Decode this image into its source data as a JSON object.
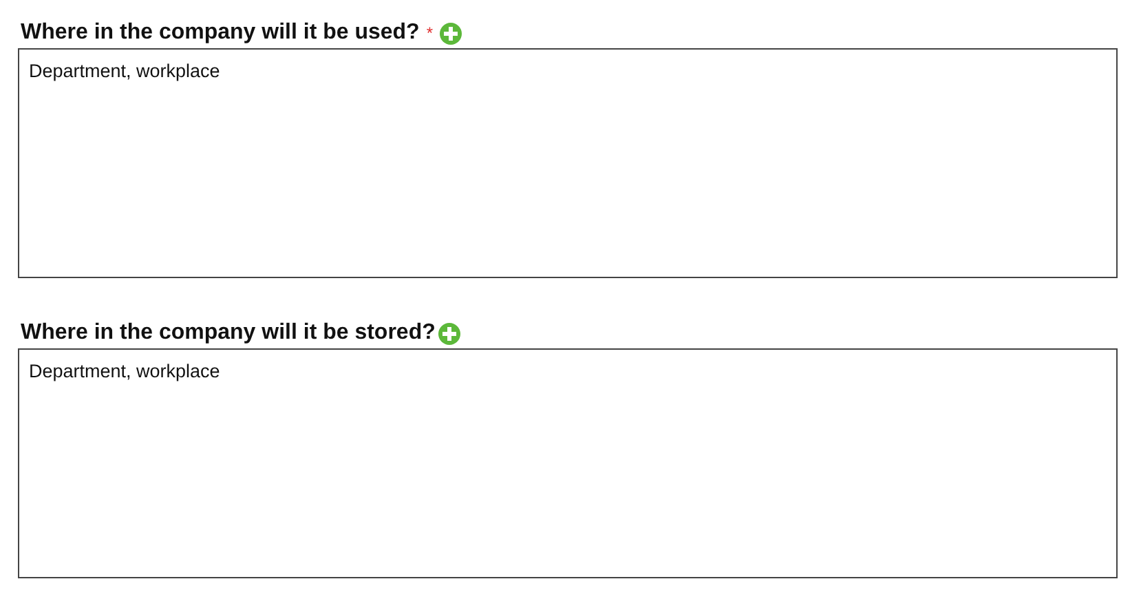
{
  "fields": [
    {
      "label": "Where in the company will it be used?",
      "required_mark": "*",
      "value": "Department, workplace"
    },
    {
      "label": "Where in the company will it be stored?",
      "value": "Department, workplace"
    }
  ]
}
